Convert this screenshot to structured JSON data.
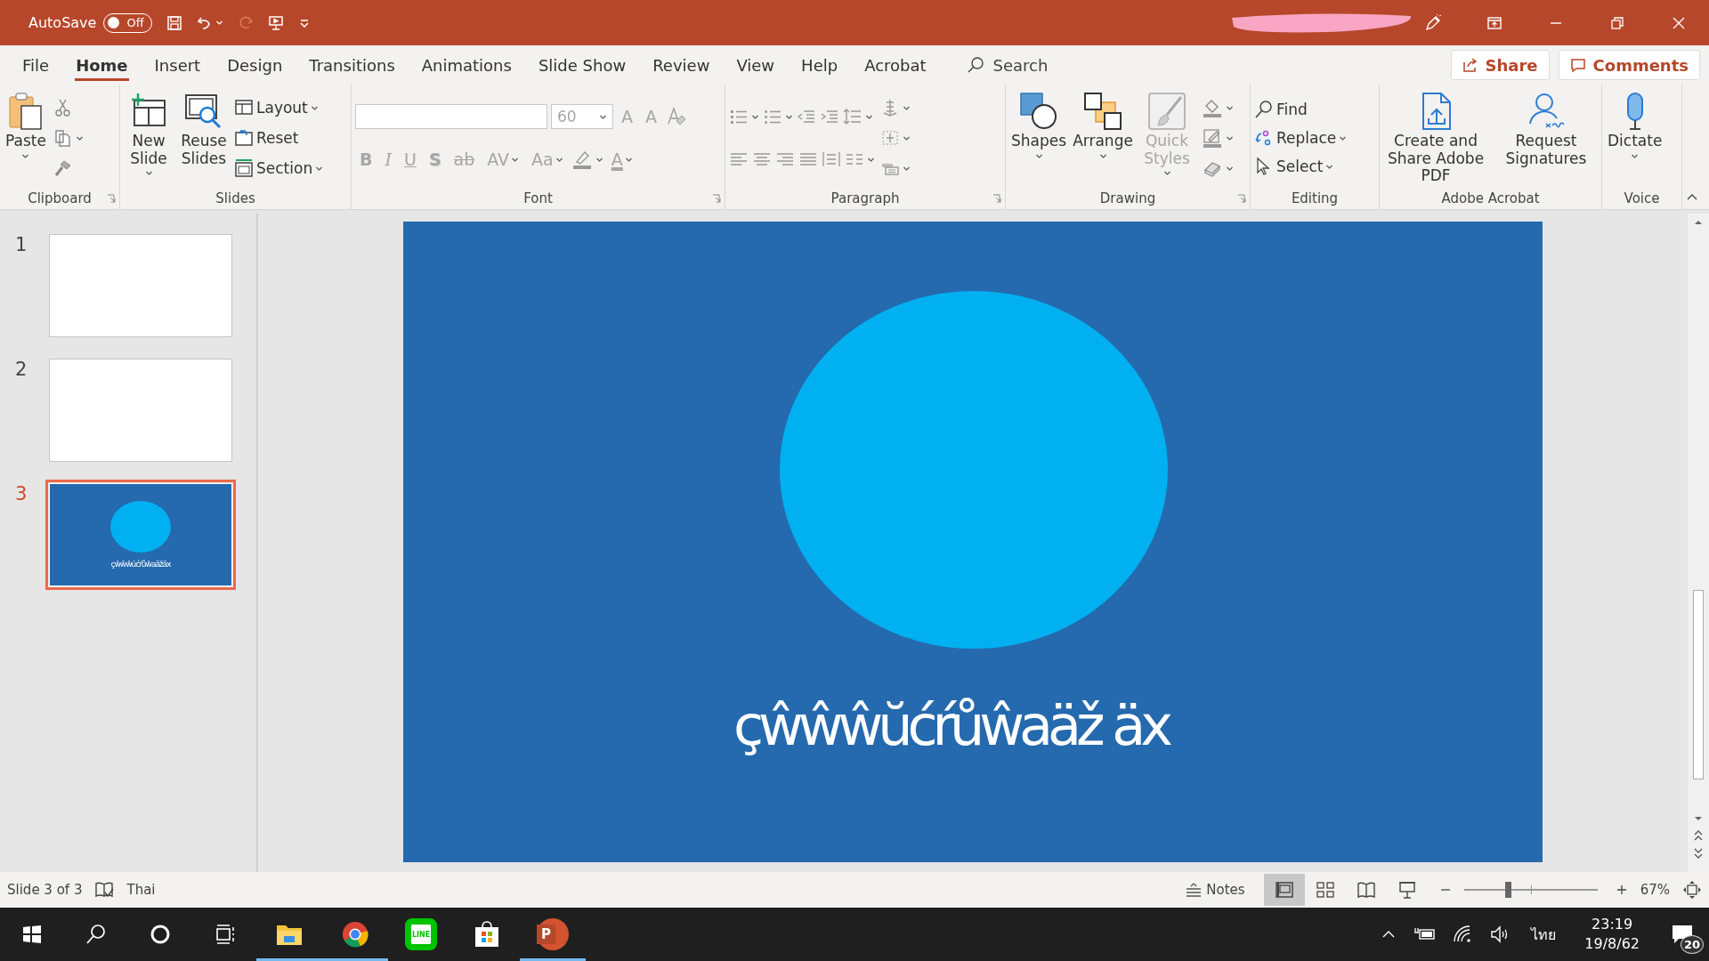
{
  "title_bar": {
    "autosave": {
      "label": "AutoSave",
      "on": false,
      "state_text": "Off"
    },
    "quick_access": [
      {
        "kind": "save"
      },
      {
        "kind": "undo",
        "dropdown": true
      },
      {
        "kind": "redo",
        "disabled": true
      },
      {
        "kind": "present"
      },
      {
        "kind": "customize"
      }
    ],
    "controls": [
      {
        "kind": "pen"
      },
      {
        "kind": "ribbon-display"
      },
      {
        "kind": "minimize"
      },
      {
        "kind": "restore"
      },
      {
        "kind": "close"
      }
    ]
  },
  "tabs": [
    {
      "label": "File",
      "selected": false
    },
    {
      "label": "Home",
      "selected": true
    },
    {
      "label": "Insert",
      "selected": false
    },
    {
      "label": "Design",
      "selected": false
    },
    {
      "label": "Transitions",
      "selected": false
    },
    {
      "label": "Animations",
      "selected": false
    },
    {
      "label": "Slide Show",
      "selected": false
    },
    {
      "label": "Review",
      "selected": false
    },
    {
      "label": "View",
      "selected": false
    },
    {
      "label": "Help",
      "selected": false
    },
    {
      "label": "Acrobat",
      "selected": false
    }
  ],
  "search": {
    "placeholder": "Search"
  },
  "share_button": "Share",
  "comments_button": "Comments",
  "ribbon": [
    {
      "title": "Clipboard",
      "launcher": true,
      "columns": [
        [
          {
            "kind": "paste",
            "label": "Paste",
            "dropdown": true
          }
        ],
        [
          {
            "kind": "cut"
          },
          {
            "kind": "copy",
            "dropdown": true
          },
          {
            "kind": "format-painter"
          }
        ]
      ]
    },
    {
      "title": "Slides",
      "launcher": false,
      "columns": [
        [
          {
            "kind": "new-slide",
            "label": "New Slide",
            "dropdown": true
          }
        ],
        [
          {
            "kind": "reuse-slides",
            "label": "Reuse Slides"
          }
        ],
        [
          {
            "kind": "layout",
            "label": "Layout",
            "dropdown": true
          },
          {
            "kind": "reset",
            "label": "Reset"
          },
          {
            "kind": "section",
            "label": "Section",
            "dropdown": true
          }
        ]
      ]
    },
    {
      "title": "Font",
      "launcher": true,
      "disabled": true,
      "columns": [
        [
          [
            {
              "kind": "font-field"
            },
            {
              "kind": "size-field",
              "value": "60"
            },
            {
              "kind": "grow",
              "label": "A"
            },
            {
              "kind": "shrink",
              "label": "A"
            },
            {
              "kind": "clear-format"
            }
          ],
          [
            {
              "kind": "bold",
              "label": "B"
            },
            {
              "kind": "italic",
              "label": "I"
            },
            {
              "kind": "underline",
              "label": "U"
            },
            {
              "kind": "shadow",
              "label": "S"
            },
            {
              "kind": "strike",
              "label": "ab"
            },
            {
              "kind": "spacing",
              "label": "AV",
              "dropdown": true
            },
            {
              "kind": "case",
              "label": "Aa",
              "dropdown": true
            },
            {
              "kind": "highlight",
              "dropdown": true
            },
            {
              "kind": "font-color",
              "label": "A",
              "dropdown": true
            }
          ]
        ]
      ]
    },
    {
      "title": "Paragraph",
      "launcher": true,
      "columns": [
        [
          [
            {
              "kind": "bullets",
              "dropdown": true
            },
            {
              "kind": "numbering",
              "dropdown": true
            },
            {
              "kind": "decrease-indent"
            },
            {
              "kind": "increase-indent"
            },
            {
              "kind": "line-spacing",
              "dropdown": true
            }
          ],
          [
            {
              "kind": "align-left"
            },
            {
              "kind": "align-center"
            },
            {
              "kind": "align-right"
            },
            {
              "kind": "justify"
            },
            {
              "kind": "distributed"
            },
            {
              "kind": "columns",
              "dropdown": true
            }
          ]
        ],
        [
          {
            "kind": "text-direction",
            "dropdown": true
          },
          {
            "kind": "align-text",
            "dropdown": true
          },
          {
            "kind": "smartart",
            "dropdown": true
          }
        ]
      ]
    },
    {
      "title": "Drawing",
      "launcher": true,
      "columns": [
        [
          {
            "kind": "shapes",
            "label": "Shapes",
            "dropdown": true
          }
        ],
        [
          {
            "kind": "arrange",
            "label": "Arrange",
            "dropdown": true
          }
        ],
        [
          {
            "kind": "quick-styles",
            "label": "Quick Styles",
            "dropdown": true,
            "disabled": true
          }
        ],
        [
          {
            "kind": "fill",
            "dropdown": true
          },
          {
            "kind": "outline",
            "dropdown": true
          },
          {
            "kind": "effects",
            "dropdown": true
          }
        ]
      ]
    },
    {
      "title": "Editing",
      "launcher": false,
      "columns": [
        [
          {
            "kind": "find",
            "label": "Find"
          },
          {
            "kind": "replace",
            "label": "Replace",
            "dropdown": true
          },
          {
            "kind": "select",
            "label": "Select",
            "dropdown": true
          }
        ]
      ]
    },
    {
      "title": "Adobe Acrobat",
      "launcher": false,
      "columns": [
        [
          {
            "kind": "create-pdf",
            "label": "Create and Share Adobe PDF"
          }
        ],
        [
          {
            "kind": "signatures",
            "label": "Request Signatures"
          }
        ]
      ]
    },
    {
      "title": "Voice",
      "launcher": false,
      "columns": [
        [
          {
            "kind": "dictate",
            "label": "Dictate",
            "dropdown": true
          }
        ]
      ]
    }
  ],
  "thumbnails": [
    {
      "number": "1",
      "selected": false,
      "kind": "blank"
    },
    {
      "number": "2",
      "selected": false,
      "kind": "blank"
    },
    {
      "number": "3",
      "selected": true,
      "kind": "circle",
      "text": "çŵŵŵŭćŕůŵaäžäx"
    }
  ],
  "slide": {
    "text": "çŵŵŵŭćŕůŵaäž äx"
  },
  "status_bar": {
    "slide_info": "Slide 3 of 3",
    "language": "Thai",
    "notes": "Notes",
    "views": [
      {
        "kind": "normal",
        "selected": true
      },
      {
        "kind": "sorter",
        "selected": false
      },
      {
        "kind": "reading",
        "selected": false
      },
      {
        "kind": "slideshow",
        "selected": false
      }
    ],
    "zoom": {
      "level": 0.33,
      "reading": "67%"
    }
  },
  "taskbar": {
    "apps": [
      {
        "kind": "explorer",
        "running": true
      },
      {
        "kind": "chrome",
        "running": true
      },
      {
        "kind": "line",
        "label": "LINE",
        "running": false
      },
      {
        "kind": "store",
        "running": false
      },
      {
        "kind": "powerpoint",
        "label": "P",
        "running": true
      }
    ],
    "input_language": "ไทย",
    "time": "23:19",
    "date": "19/8/62",
    "notifications": "20"
  }
}
